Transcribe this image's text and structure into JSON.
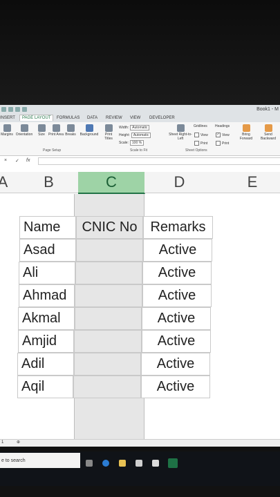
{
  "window": {
    "title": "Book1 - M"
  },
  "ribbon": {
    "tabs": [
      "INSERT",
      "PAGE LAYOUT",
      "FORMULAS",
      "DATA",
      "REVIEW",
      "VIEW",
      "DEVELOPER"
    ],
    "active_tab": "PAGE LAYOUT",
    "page_setup": {
      "margins": "Margins",
      "orientation": "Orientation",
      "size": "Size",
      "print_area": "Print Area",
      "breaks": "Breaks",
      "background": "Background",
      "print_titles": "Print Titles",
      "group": "Page Setup"
    },
    "scale_to_fit": {
      "width_label": "Width:",
      "width_value": "Automatic",
      "height_label": "Height:",
      "height_value": "Automatic",
      "scale_label": "Scale:",
      "scale_value": "100 %",
      "group": "Scale to Fit"
    },
    "sheet_options": {
      "sheet_rtl": "Sheet Right-to-Left",
      "gridlines": "Gridlines",
      "headings": "Headings",
      "view": "View",
      "print": "Print",
      "group": "Sheet Options"
    },
    "arrange": {
      "bring_forward": "Bring Forward",
      "send_backward": "Send Backward"
    }
  },
  "formula_bar": {
    "cancel": "×",
    "enter": "✓",
    "fx": "fx"
  },
  "columns": [
    "A",
    "B",
    "C",
    "D",
    "E"
  ],
  "selected_column": "C",
  "table": {
    "headers": [
      "Name",
      "CNIC No",
      "Remarks"
    ],
    "rows": [
      {
        "name": "Asad",
        "cnic": "",
        "remarks": "Active"
      },
      {
        "name": "Ali",
        "cnic": "",
        "remarks": "Active"
      },
      {
        "name": "Ahmad",
        "cnic": "",
        "remarks": "Active"
      },
      {
        "name": "Akmal",
        "cnic": "",
        "remarks": "Active"
      },
      {
        "name": "Amjid",
        "cnic": "",
        "remarks": "Active"
      },
      {
        "name": "Adil",
        "cnic": "",
        "remarks": "Active"
      },
      {
        "name": "Aqil",
        "cnic": "",
        "remarks": "Active"
      }
    ]
  },
  "sheetbar": {
    "sheet": "1"
  },
  "taskbar": {
    "search_placeholder": "e to search"
  }
}
